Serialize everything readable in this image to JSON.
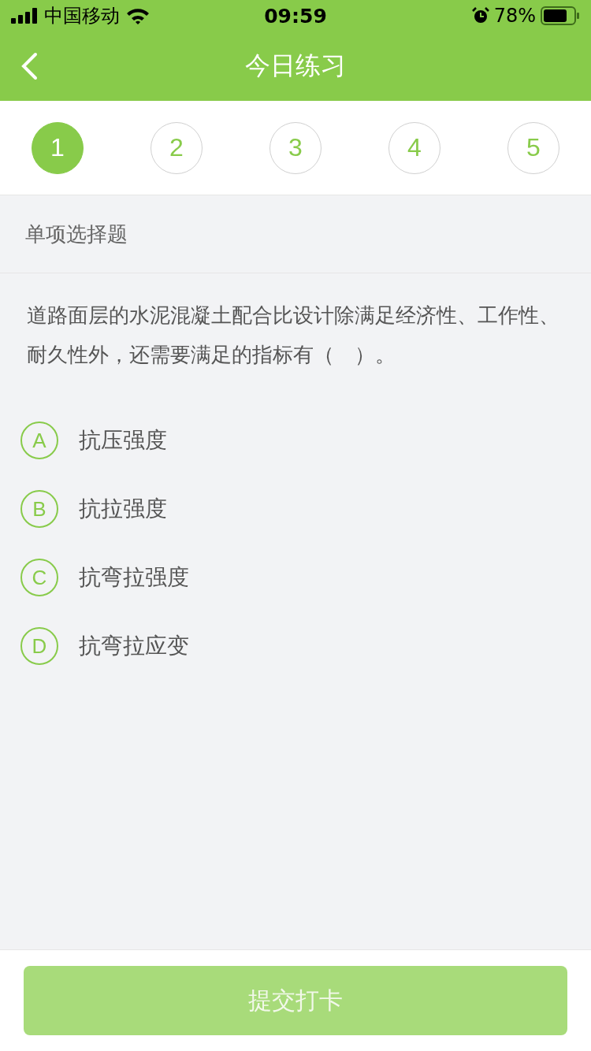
{
  "status_bar": {
    "carrier": "中国移动",
    "time": "09:59",
    "battery": "78%"
  },
  "nav": {
    "title": "今日练习"
  },
  "steps": [
    {
      "label": "1",
      "selected": true
    },
    {
      "label": "2",
      "selected": false
    },
    {
      "label": "3",
      "selected": false
    },
    {
      "label": "4",
      "selected": false
    },
    {
      "label": "5",
      "selected": false
    }
  ],
  "question": {
    "type": "单项选择题",
    "text": "道路面层的水泥混凝土配合比设计除满足经济性、工作性、耐久性外，还需要满足的指标有（　）。",
    "options": [
      {
        "letter": "A",
        "text": "抗压强度",
        "selected": false
      },
      {
        "letter": "B",
        "text": "抗拉强度",
        "selected": false
      },
      {
        "letter": "C",
        "text": "抗弯拉强度",
        "selected": false
      },
      {
        "letter": "D",
        "text": "抗弯拉应变",
        "selected": false
      }
    ]
  },
  "submit": {
    "label": "提交打卡",
    "disabled": true
  }
}
